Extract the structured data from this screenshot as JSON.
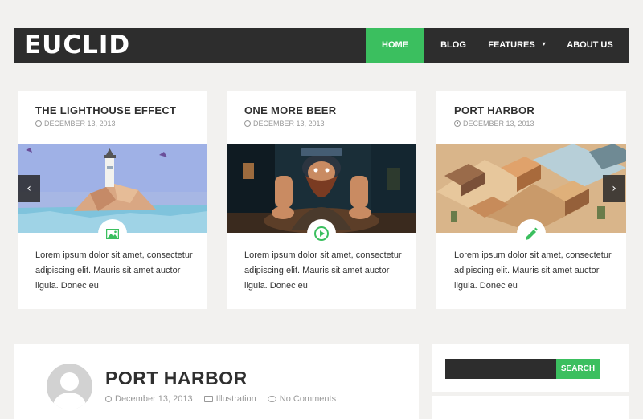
{
  "site": {
    "logo": "EUCLID"
  },
  "nav": {
    "items": [
      {
        "label": "HOME",
        "active": true
      },
      {
        "label": "BLOG",
        "active": false
      },
      {
        "label": "FEATURES",
        "active": false,
        "has_dropdown": true
      },
      {
        "label": "ABOUT US",
        "active": false
      }
    ]
  },
  "slider": {
    "prev_icon": "chevron-left-icon",
    "next_icon": "chevron-right-icon",
    "cards": [
      {
        "title": "THE LIGHTHOUSE EFFECT",
        "date": "DECEMBER 13, 2013",
        "type_icon": "image-icon",
        "excerpt": "Lorem ipsum dolor sit amet, consectetur adipiscing elit. Mauris sit amet auctor ligula. Donec eu"
      },
      {
        "title": "ONE MORE BEER",
        "date": "DECEMBER 13, 2013",
        "type_icon": "play-icon",
        "excerpt": "Lorem ipsum dolor sit amet, consectetur adipiscing elit. Mauris sit amet auctor ligula. Donec eu"
      },
      {
        "title": "PORT HARBOR",
        "date": "DECEMBER 13, 2013",
        "type_icon": "pencil-icon",
        "excerpt": "Lorem ipsum dolor sit amet, consectetur adipiscing elit. Mauris sit amet auctor ligula. Donec eu"
      }
    ]
  },
  "post": {
    "title": "PORT HARBOR",
    "date": "December 13, 2013",
    "category": "Illustration",
    "comments": "No Comments"
  },
  "sidebar": {
    "search_placeholder": "",
    "search_button": "SEARCH"
  },
  "colors": {
    "accent": "#3bbf5f",
    "dark": "#2d2d2d",
    "background": "#f2f1ef"
  }
}
